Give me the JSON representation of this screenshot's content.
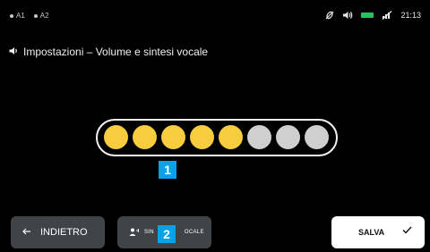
{
  "status": {
    "left_items": [
      "A1",
      "A2"
    ],
    "time": "21:13",
    "icons": [
      "no-gps-icon",
      "speaker-icon",
      "battery-icon",
      "no-signal-icon"
    ]
  },
  "title": {
    "text": "Impostazioni  –  Volume e sintesi vocale",
    "icon": "speaker-icon"
  },
  "volume": {
    "level": 5,
    "max": 8,
    "on_color": "#f5cd3f",
    "off_color": "#cfcfcf"
  },
  "badges": [
    "1",
    "2"
  ],
  "buttons": {
    "back_label": "INDIETRO",
    "voice_label_left": "SIN",
    "voice_label_right": "OCALE",
    "save_label": "SALVA"
  }
}
